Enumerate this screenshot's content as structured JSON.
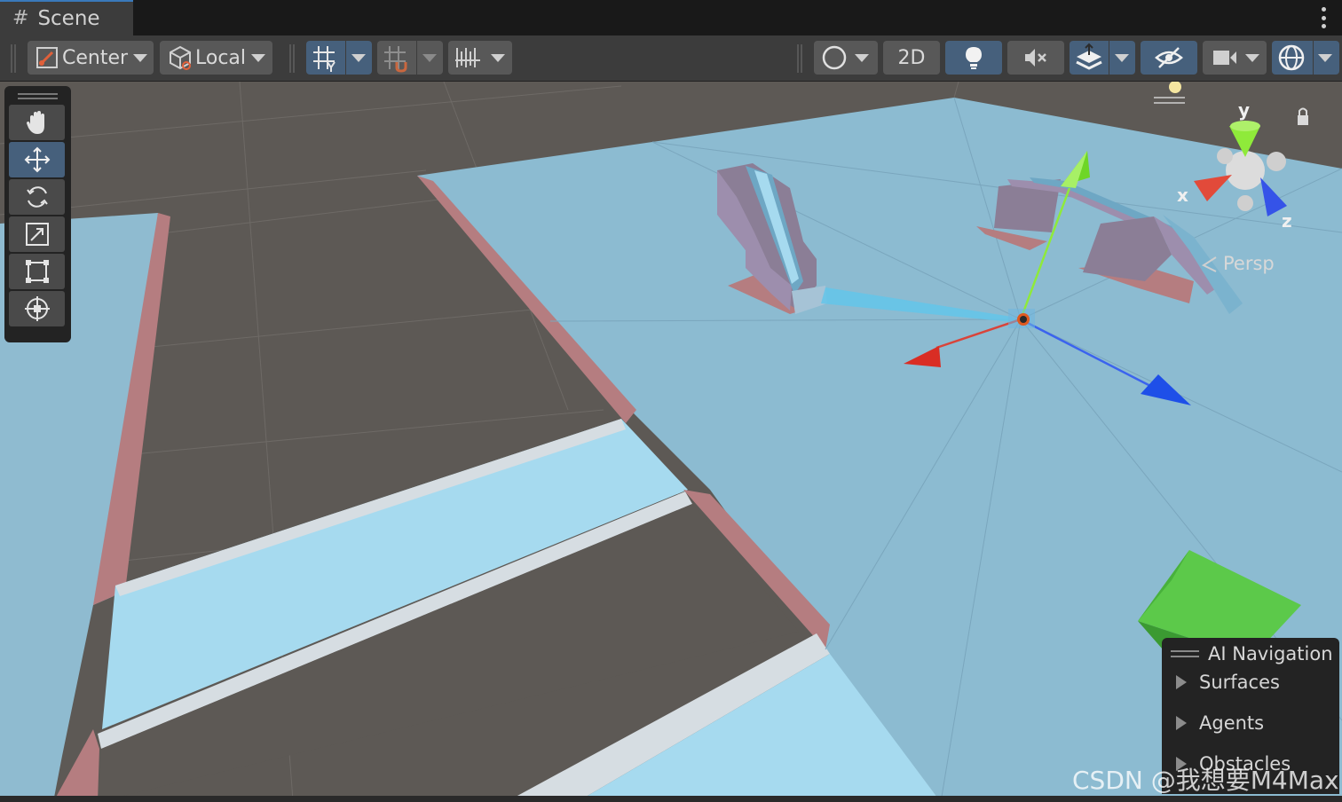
{
  "tab": {
    "title": "Scene"
  },
  "toolbar": {
    "pivot_label": "Center",
    "space_label": "Local",
    "mode_2d_label": "2D"
  },
  "tools": [
    "hand-tool",
    "move-tool",
    "rotate-tool",
    "scale-tool",
    "rect-tool",
    "transform-tool"
  ],
  "gizmo": {
    "x_label": "x",
    "y_label": "y",
    "z_label": "z",
    "projection_label": "Persp"
  },
  "ai_navigation": {
    "title": "AI Navigation",
    "items": [
      "Surfaces",
      "Agents",
      "Obstacles"
    ]
  },
  "watermark": "CSDN @我想要M4Max",
  "colors": {
    "navmesh": "#8fbbd0",
    "navmesh_light": "#a6daef",
    "ground": "#5d5955",
    "edge": "#b57d80",
    "axis_x": "#d92d24",
    "axis_y": "#8fea3a",
    "axis_z": "#1e4fe8",
    "active_button": "#46607c"
  }
}
